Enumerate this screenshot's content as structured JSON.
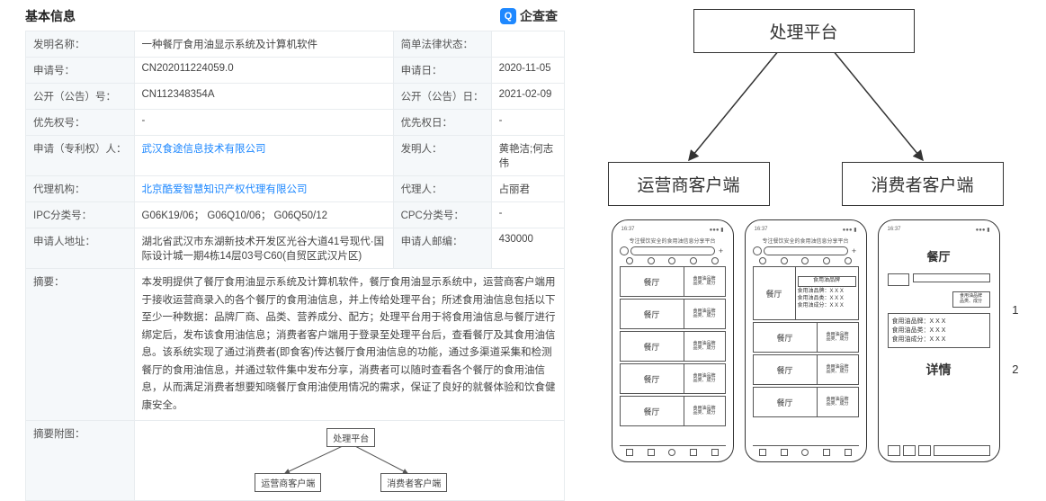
{
  "header": {
    "title": "基本信息",
    "brand": "企查查"
  },
  "table": {
    "r1": {
      "l1": "发明名称：",
      "v1": "一种餐厅食用油显示系统及计算机软件",
      "l2": "简单法律状态：",
      "v2": ""
    },
    "r2": {
      "l1": "申请号：",
      "v1": "CN202011224059.0",
      "l2": "申请日：",
      "v2": "2020-11-05"
    },
    "r3": {
      "l1": "公开（公告）号：",
      "v1": "CN112348354A",
      "l2": "公开（公告）日：",
      "v2": "2021-02-09"
    },
    "r4": {
      "l1": "优先权号：",
      "v1": "-",
      "l2": "优先权日：",
      "v2": "-"
    },
    "r5": {
      "l1": "申请（专利权）人：",
      "v1": "武汉食途信息技术有限公司",
      "l2": "发明人：",
      "v2": "黄艳洁;何志伟"
    },
    "r6": {
      "l1": "代理机构：",
      "v1": "北京酷爱智慧知识产权代理有限公司",
      "l2": "代理人：",
      "v2": "占丽君"
    },
    "r7": {
      "l1": "IPC分类号：",
      "v1": "G06K19/06； G06Q10/06； G06Q50/12",
      "l2": "CPC分类号：",
      "v2": "-"
    },
    "r8": {
      "l1": "申请人地址：",
      "v1": "湖北省武汉市东湖新技术开发区光谷大道41号现代·国际设计城一期4栋14层03号C60(自贸区武汉片区)",
      "l2": "申请人邮编：",
      "v2": "430000"
    },
    "abstract_label": "摘要：",
    "abstract": "本发明提供了餐厅食用油显示系统及计算机软件，餐厅食用油显示系统中，运营商客户端用于接收运营商录入的各个餐厅的食用油信息，并上传给处理平台；所述食用油信息包括以下至少一种数据：品牌厂商、品类、营养成分、配方；处理平台用于将食用油信息与餐厅进行绑定后，发布该食用油信息；消费者客户端用于登录至处理平台后，查看餐厅及其食用油信息。该系统实现了通过消费者(即食客)传达餐厅食用油信息的功能，通过多渠道采集和检测餐厅的食用油信息，并通过软件集中发布分享，消费者可以随时查看各个餐厅的食用油信息，从而满足消费者想要知晓餐厅食用油使用情况的需求，保证了良好的就餐体验和饮食健康安全。",
    "figure_label": "摘要附图："
  },
  "diagram": {
    "platform": "处理平台",
    "left_client": "运营商客户端",
    "right_client": "消费者客户端",
    "mini_platform": "处理平台",
    "mini_left": "运营商客户端",
    "mini_right": "消费者客户端"
  },
  "phone": {
    "title_long": "专注餐饮安全的食用油信息分享平台",
    "restaurant": "餐厅",
    "brand_line": "食用油品牌",
    "tag_sub": "品类、成分",
    "oil_brand": "食用油品牌：X X X",
    "oil_type": "食用油品类：X X X",
    "oil_ingredient": "食用油成分：X X X",
    "detail": "详情",
    "callout_1": "1",
    "callout_2": "2"
  }
}
